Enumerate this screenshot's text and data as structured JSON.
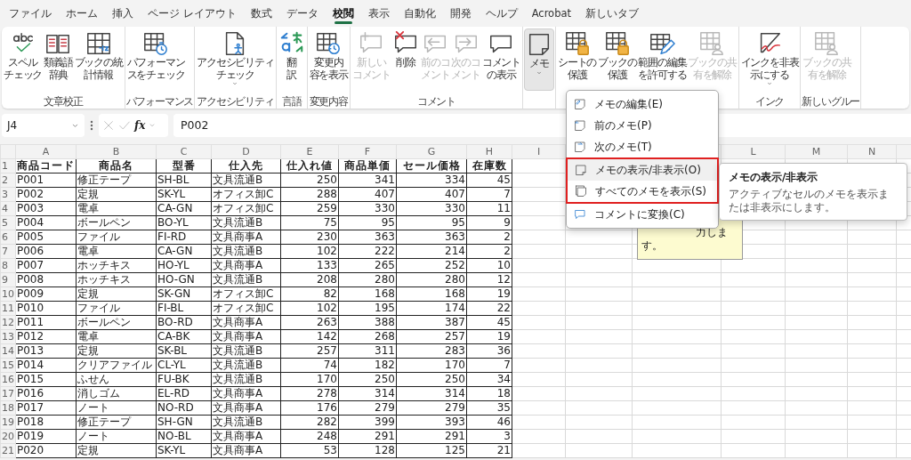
{
  "menu_tabs": [
    {
      "label": "ファイル",
      "selected": false
    },
    {
      "label": "ホーム",
      "selected": false
    },
    {
      "label": "挿入",
      "selected": false
    },
    {
      "label": "ページ レイアウト",
      "selected": false
    },
    {
      "label": "数式",
      "selected": false
    },
    {
      "label": "データ",
      "selected": false
    },
    {
      "label": "校閲",
      "selected": true
    },
    {
      "label": "表示",
      "selected": false
    },
    {
      "label": "自動化",
      "selected": false
    },
    {
      "label": "開発",
      "selected": false
    },
    {
      "label": "ヘルプ",
      "selected": false
    },
    {
      "label": "Acrobat",
      "selected": false
    },
    {
      "label": "新しいタブ",
      "selected": false
    }
  ],
  "ribbon": {
    "groups": [
      {
        "label": "文章校正",
        "buttons": [
          {
            "lines": [
              "スペル",
              "チェック"
            ],
            "disabled": false,
            "pressed": false,
            "dropdown": false
          },
          {
            "lines": [
              "類義語",
              "辞典"
            ],
            "disabled": false,
            "pressed": false,
            "dropdown": false
          },
          {
            "lines": [
              "ブックの統",
              "計情報"
            ],
            "disabled": false,
            "pressed": false,
            "dropdown": false
          }
        ]
      },
      {
        "label": "パフォーマンス",
        "buttons": [
          {
            "lines": [
              "パフォーマン",
              "スをチェック"
            ],
            "disabled": false,
            "pressed": false,
            "dropdown": false
          }
        ]
      },
      {
        "label": "アクセシビリティ",
        "buttons": [
          {
            "lines": [
              "アクセシビリティ",
              "チェック"
            ],
            "disabled": false,
            "pressed": false,
            "dropdown": true
          }
        ]
      },
      {
        "label": "言語",
        "buttons": [
          {
            "lines": [
              "翻",
              "訳"
            ],
            "disabled": false,
            "pressed": false,
            "dropdown": false
          }
        ]
      },
      {
        "label": "変更内容",
        "buttons": [
          {
            "lines": [
              "変更内",
              "容を表示"
            ],
            "disabled": false,
            "pressed": false,
            "dropdown": false
          }
        ]
      },
      {
        "label": "コメント",
        "buttons": [
          {
            "lines": [
              "新しい",
              "コメント"
            ],
            "disabled": true,
            "pressed": false,
            "dropdown": false
          },
          {
            "lines": [
              "削除"
            ],
            "disabled": false,
            "pressed": false,
            "dropdown": false
          },
          {
            "lines": [
              "前のコ",
              "メント"
            ],
            "disabled": true,
            "pressed": false,
            "dropdown": false
          },
          {
            "lines": [
              "次のコ",
              "メント"
            ],
            "disabled": true,
            "pressed": false,
            "dropdown": false
          },
          {
            "lines": [
              "コメント",
              "の表示"
            ],
            "disabled": false,
            "pressed": false,
            "dropdown": false
          }
        ]
      },
      {
        "buttons": [
          {
            "lines": [
              "メモ"
            ],
            "disabled": false,
            "pressed": true,
            "dropdown": true
          }
        ]
      },
      {
        "buttons": [
          {
            "lines": [
              "シートの",
              "保護"
            ],
            "disabled": false,
            "pressed": false,
            "dropdown": false
          },
          {
            "lines": [
              "ブックの",
              "保護"
            ],
            "disabled": false,
            "pressed": false,
            "dropdown": false
          },
          {
            "lines": [
              "範囲の編集",
              "を許可する"
            ],
            "disabled": false,
            "pressed": false,
            "dropdown": false
          },
          {
            "lines": [
              "ブックの共",
              "有を解除"
            ],
            "disabled": true,
            "pressed": false,
            "dropdown": false
          }
        ]
      },
      {
        "label": "インク",
        "buttons": [
          {
            "lines": [
              "インクを非表",
              "示にする"
            ],
            "disabled": false,
            "pressed": false,
            "dropdown": true
          }
        ]
      },
      {
        "label": "新しいグルー",
        "buttons": [
          {
            "lines": [
              "ブックの共",
              "有を解除"
            ],
            "disabled": true,
            "pressed": false,
            "dropdown": false
          }
        ]
      }
    ]
  },
  "formula_bar": {
    "name_box": "J4",
    "function_label": "fx",
    "value": "P002"
  },
  "sheet": {
    "column_letters": [
      "A",
      "B",
      "C",
      "D",
      "E",
      "F",
      "G",
      "H",
      "I",
      "L",
      "M",
      "N"
    ],
    "rows": [
      {
        "number": "1",
        "cells": [
          "商品コード",
          "商品名",
          "型番",
          "仕入先",
          "仕入れ値",
          "商品単価",
          "セール価格",
          "在庫数"
        ]
      },
      {
        "number": "2",
        "cells": [
          "P001",
          "修正テープ",
          "SH-BL",
          "文具流通B",
          "250",
          "341",
          "334",
          "45"
        ]
      },
      {
        "number": "3",
        "cells": [
          "P002",
          "定規",
          "SK-YL",
          "オフィス卸C",
          "288",
          "407",
          "407",
          "7"
        ]
      },
      {
        "number": "4",
        "cells": [
          "P003",
          "電卓",
          "CA-GN",
          "オフィス卸C",
          "259",
          "330",
          "330",
          "11"
        ]
      },
      {
        "number": "5",
        "cells": [
          "P004",
          "ボールペン",
          "BO-YL",
          "文具流通B",
          "75",
          "95",
          "95",
          "9"
        ]
      },
      {
        "number": "6",
        "cells": [
          "P005",
          "ファイル",
          "FI-RD",
          "文具商事A",
          "230",
          "363",
          "363",
          "2"
        ]
      },
      {
        "number": "7",
        "cells": [
          "P006",
          "電卓",
          "CA-GN",
          "文具流通B",
          "102",
          "222",
          "214",
          "2"
        ]
      },
      {
        "number": "8",
        "cells": [
          "P007",
          "ホッチキス",
          "HO-YL",
          "文具商事A",
          "133",
          "265",
          "252",
          "10"
        ]
      },
      {
        "number": "9",
        "cells": [
          "P008",
          "ホッチキス",
          "HO-GN",
          "文具流通B",
          "208",
          "280",
          "280",
          "12"
        ]
      },
      {
        "number": "10",
        "cells": [
          "P009",
          "定規",
          "SK-GN",
          "オフィス卸C",
          "82",
          "168",
          "168",
          "19"
        ]
      },
      {
        "number": "11",
        "cells": [
          "P010",
          "ファイル",
          "FI-BL",
          "オフィス卸C",
          "102",
          "195",
          "174",
          "22"
        ]
      },
      {
        "number": "12",
        "cells": [
          "P011",
          "ボールペン",
          "BO-RD",
          "文具商事A",
          "263",
          "388",
          "387",
          "45"
        ]
      },
      {
        "number": "13",
        "cells": [
          "P012",
          "電卓",
          "CA-BK",
          "文具商事A",
          "142",
          "268",
          "257",
          "19"
        ]
      },
      {
        "number": "14",
        "cells": [
          "P013",
          "定規",
          "SK-BL",
          "文具流通B",
          "257",
          "311",
          "283",
          "36"
        ]
      },
      {
        "number": "15",
        "cells": [
          "P014",
          "クリアファイル",
          "CL-YL",
          "文具流通B",
          "74",
          "182",
          "170",
          "7"
        ]
      },
      {
        "number": "16",
        "cells": [
          "P015",
          "ふせん",
          "FU-BK",
          "文具流通B",
          "170",
          "250",
          "250",
          "34"
        ]
      },
      {
        "number": "17",
        "cells": [
          "P016",
          "消しゴム",
          "EL-RD",
          "文具商事A",
          "278",
          "314",
          "314",
          "18"
        ]
      },
      {
        "number": "18",
        "cells": [
          "P017",
          "ノート",
          "NO-RD",
          "文具商事A",
          "176",
          "279",
          "279",
          "35"
        ]
      },
      {
        "number": "19",
        "cells": [
          "P018",
          "修正テープ",
          "SH-GN",
          "文具流通B",
          "282",
          "399",
          "393",
          "46"
        ]
      },
      {
        "number": "20",
        "cells": [
          "P019",
          "ノート",
          "NO-BL",
          "文具商事A",
          "248",
          "291",
          "291",
          "3"
        ]
      },
      {
        "number": "21",
        "cells": [
          "P020",
          "定規",
          "SK-YL",
          "文具商事A",
          "53",
          "128",
          "125",
          "21"
        ]
      }
    ]
  },
  "note": {
    "lines": [
      "力しま",
      "す。"
    ]
  },
  "menu": {
    "items": [
      {
        "label": "メモの編集(E)",
        "hovered": false,
        "emphasized": false
      },
      {
        "label": "前のメモ(P)",
        "hovered": false,
        "emphasized": false
      },
      {
        "label": "次のメモ(T)",
        "hovered": false,
        "emphasized": false
      },
      {
        "label": "メモの表示/非表示(O)",
        "hovered": true,
        "emphasized": true
      },
      {
        "label": "すべてのメモを表示(S)",
        "hovered": false,
        "emphasized": true
      },
      {
        "label": "コメントに変換(C)",
        "hovered": false,
        "emphasized": false
      }
    ]
  },
  "tooltip": {
    "title": "メモの表示/非表示",
    "text": "アクティブなセルのメモを表示または非表示にします。"
  }
}
